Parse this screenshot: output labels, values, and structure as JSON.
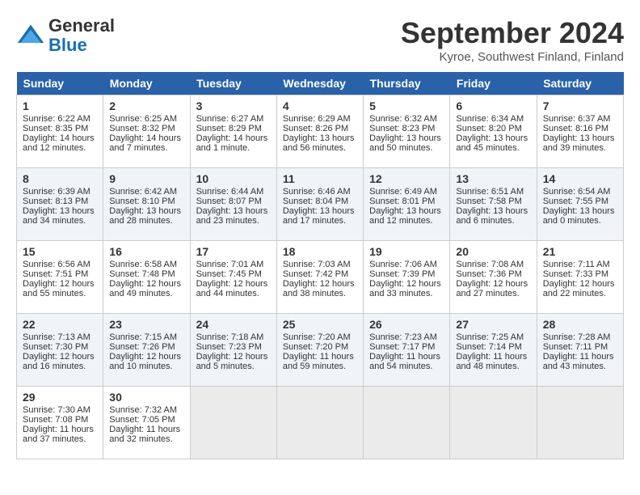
{
  "header": {
    "logo_general": "General",
    "logo_blue": "Blue",
    "title": "September 2024",
    "location": "Kyroe, Southwest Finland, Finland"
  },
  "columns": [
    "Sunday",
    "Monday",
    "Tuesday",
    "Wednesday",
    "Thursday",
    "Friday",
    "Saturday"
  ],
  "weeks": [
    [
      {
        "day": "1",
        "sunrise": "6:22 AM",
        "sunset": "8:35 PM",
        "daylight": "14 hours and 12 minutes."
      },
      {
        "day": "2",
        "sunrise": "6:25 AM",
        "sunset": "8:32 PM",
        "daylight": "14 hours and 7 minutes."
      },
      {
        "day": "3",
        "sunrise": "6:27 AM",
        "sunset": "8:29 PM",
        "daylight": "14 hours and 1 minute."
      },
      {
        "day": "4",
        "sunrise": "6:29 AM",
        "sunset": "8:26 PM",
        "daylight": "13 hours and 56 minutes."
      },
      {
        "day": "5",
        "sunrise": "6:32 AM",
        "sunset": "8:23 PM",
        "daylight": "13 hours and 50 minutes."
      },
      {
        "day": "6",
        "sunrise": "6:34 AM",
        "sunset": "8:20 PM",
        "daylight": "13 hours and 45 minutes."
      },
      {
        "day": "7",
        "sunrise": "6:37 AM",
        "sunset": "8:16 PM",
        "daylight": "13 hours and 39 minutes."
      }
    ],
    [
      {
        "day": "8",
        "sunrise": "6:39 AM",
        "sunset": "8:13 PM",
        "daylight": "13 hours and 34 minutes."
      },
      {
        "day": "9",
        "sunrise": "6:42 AM",
        "sunset": "8:10 PM",
        "daylight": "13 hours and 28 minutes."
      },
      {
        "day": "10",
        "sunrise": "6:44 AM",
        "sunset": "8:07 PM",
        "daylight": "13 hours and 23 minutes."
      },
      {
        "day": "11",
        "sunrise": "6:46 AM",
        "sunset": "8:04 PM",
        "daylight": "13 hours and 17 minutes."
      },
      {
        "day": "12",
        "sunrise": "6:49 AM",
        "sunset": "8:01 PM",
        "daylight": "13 hours and 12 minutes."
      },
      {
        "day": "13",
        "sunrise": "6:51 AM",
        "sunset": "7:58 PM",
        "daylight": "13 hours and 6 minutes."
      },
      {
        "day": "14",
        "sunrise": "6:54 AM",
        "sunset": "7:55 PM",
        "daylight": "13 hours and 0 minutes."
      }
    ],
    [
      {
        "day": "15",
        "sunrise": "6:56 AM",
        "sunset": "7:51 PM",
        "daylight": "12 hours and 55 minutes."
      },
      {
        "day": "16",
        "sunrise": "6:58 AM",
        "sunset": "7:48 PM",
        "daylight": "12 hours and 49 minutes."
      },
      {
        "day": "17",
        "sunrise": "7:01 AM",
        "sunset": "7:45 PM",
        "daylight": "12 hours and 44 minutes."
      },
      {
        "day": "18",
        "sunrise": "7:03 AM",
        "sunset": "7:42 PM",
        "daylight": "12 hours and 38 minutes."
      },
      {
        "day": "19",
        "sunrise": "7:06 AM",
        "sunset": "7:39 PM",
        "daylight": "12 hours and 33 minutes."
      },
      {
        "day": "20",
        "sunrise": "7:08 AM",
        "sunset": "7:36 PM",
        "daylight": "12 hours and 27 minutes."
      },
      {
        "day": "21",
        "sunrise": "7:11 AM",
        "sunset": "7:33 PM",
        "daylight": "12 hours and 22 minutes."
      }
    ],
    [
      {
        "day": "22",
        "sunrise": "7:13 AM",
        "sunset": "7:30 PM",
        "daylight": "12 hours and 16 minutes."
      },
      {
        "day": "23",
        "sunrise": "7:15 AM",
        "sunset": "7:26 PM",
        "daylight": "12 hours and 10 minutes."
      },
      {
        "day": "24",
        "sunrise": "7:18 AM",
        "sunset": "7:23 PM",
        "daylight": "12 hours and 5 minutes."
      },
      {
        "day": "25",
        "sunrise": "7:20 AM",
        "sunset": "7:20 PM",
        "daylight": "11 hours and 59 minutes."
      },
      {
        "day": "26",
        "sunrise": "7:23 AM",
        "sunset": "7:17 PM",
        "daylight": "11 hours and 54 minutes."
      },
      {
        "day": "27",
        "sunrise": "7:25 AM",
        "sunset": "7:14 PM",
        "daylight": "11 hours and 48 minutes."
      },
      {
        "day": "28",
        "sunrise": "7:28 AM",
        "sunset": "7:11 PM",
        "daylight": "11 hours and 43 minutes."
      }
    ],
    [
      {
        "day": "29",
        "sunrise": "7:30 AM",
        "sunset": "7:08 PM",
        "daylight": "11 hours and 37 minutes."
      },
      {
        "day": "30",
        "sunrise": "7:32 AM",
        "sunset": "7:05 PM",
        "daylight": "11 hours and 32 minutes."
      },
      null,
      null,
      null,
      null,
      null
    ]
  ]
}
